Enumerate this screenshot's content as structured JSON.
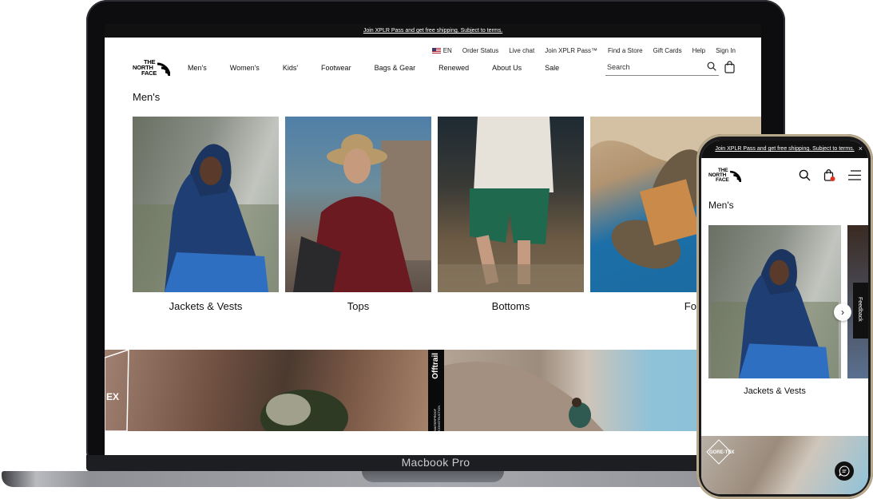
{
  "device_labels": {
    "laptop": "Macbook Pro"
  },
  "desktop": {
    "promo_bar": "Join XPLR Pass and get free shipping. Subject to terms.",
    "utility_nav": {
      "language": "EN",
      "items": [
        "Order Status",
        "Live chat",
        "Join XPLR Pass™",
        "Find a Store",
        "Gift Cards",
        "Help",
        "Sign In"
      ]
    },
    "logo": {
      "line1": "THE",
      "line2": "NORTH",
      "line3": "FACE"
    },
    "main_nav": [
      "Men's",
      "Women's",
      "Kids'",
      "Footwear",
      "Bags & Gear",
      "Renewed",
      "About Us",
      "Sale"
    ],
    "search": {
      "placeholder": "Search"
    },
    "page_title": "Men's",
    "categories": [
      "Jackets & Vests",
      "Tops",
      "Bottoms",
      "Footwear"
    ],
    "banner": {
      "badge_left": "EX",
      "strip_label": "Offtrail",
      "strip_sub": "WATERPROOF CONSTRUCTION"
    }
  },
  "mobile": {
    "promo_bar": "Join XPLR Pass and get free shipping. Subject to terms.",
    "close": "×",
    "page_title": "Men's",
    "category": "Jackets & Vests",
    "feedback": "Feedback",
    "banner_badge": "GORE-TEX"
  },
  "colors": {
    "brand_black": "#111111",
    "cart_dot": "#e0301e"
  }
}
